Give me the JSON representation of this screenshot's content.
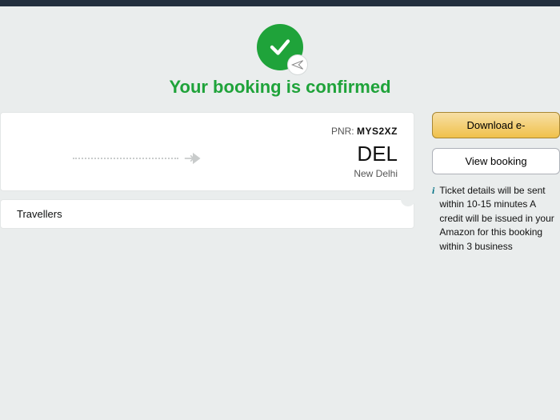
{
  "confirmation": {
    "title": "Your booking is confirmed"
  },
  "flight": {
    "pnr_label": "PNR:",
    "pnr_value": "MYS2XZ",
    "dest_code": "DEL",
    "dest_city": "New Delhi"
  },
  "travellers": {
    "label": "Travellers"
  },
  "actions": {
    "download": "Download e-",
    "view": "View booking"
  },
  "notice": {
    "text": "Ticket details will be sent within 10-15 minutes A credit will be issued in your Amazon for this booking within 3 business"
  }
}
